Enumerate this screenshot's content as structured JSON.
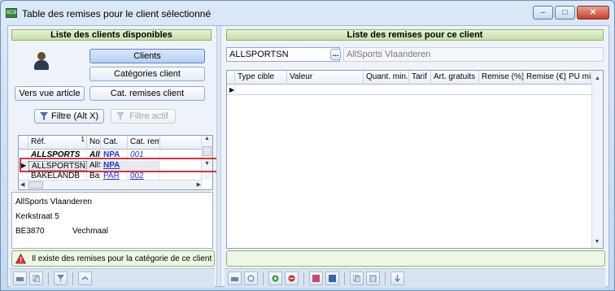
{
  "window": {
    "title": "Table des remises pour le client sélectionné",
    "icon_text": "BCB",
    "buttons": {
      "minimize": "–",
      "maximize": "□",
      "close": "✕"
    }
  },
  "left": {
    "header": "Liste des clients disponibles",
    "buttons": {
      "clients": "Clients",
      "categories": "Catégories client",
      "vers_vue": "Vers vue article",
      "cat_remises": "Cat. remises client",
      "filtre": "Filtre (Alt X)",
      "filtre_actif": "Filtre actif"
    },
    "grid": {
      "columns": [
        "Réf.",
        "Nom",
        "Cat.",
        "Cat. rem."
      ],
      "sort_indicator": "1",
      "rows": [
        {
          "ref": "ALLSPORTS",
          "nom": "AllS",
          "cat": "NPA",
          "catrem": "001"
        },
        {
          "ref": "ALLSPORTSN",
          "nom": "AllSp",
          "cat": "NPA",
          "catrem": ""
        },
        {
          "ref": "BAKELANDB",
          "nom": "Bart I",
          "cat": "PAR",
          "catrem": "002"
        }
      ]
    },
    "info": {
      "name": "AllSports Vlaanderen",
      "street": "Kerkstraat 5",
      "postcode": "BE3870",
      "city": "Vechmaal"
    },
    "warning": "Il existe des remises pour la catégorie de ce client"
  },
  "right": {
    "header": "Liste des remises pour ce client",
    "client_code": "ALLSPORTSN",
    "client_name": "AllSports Vlaanderen",
    "lookup_button": "...",
    "grid": {
      "columns": [
        "Type cible",
        "Valeur",
        "Quant. min.",
        "Tarif",
        "Art. gratuits",
        "Remise (%)",
        "Remise (€)",
        "PU min."
      ]
    }
  },
  "colors": {
    "section_green": "#c5e0a8",
    "highlight_red": "#d2353a",
    "link_blue": "#1c36d8"
  }
}
